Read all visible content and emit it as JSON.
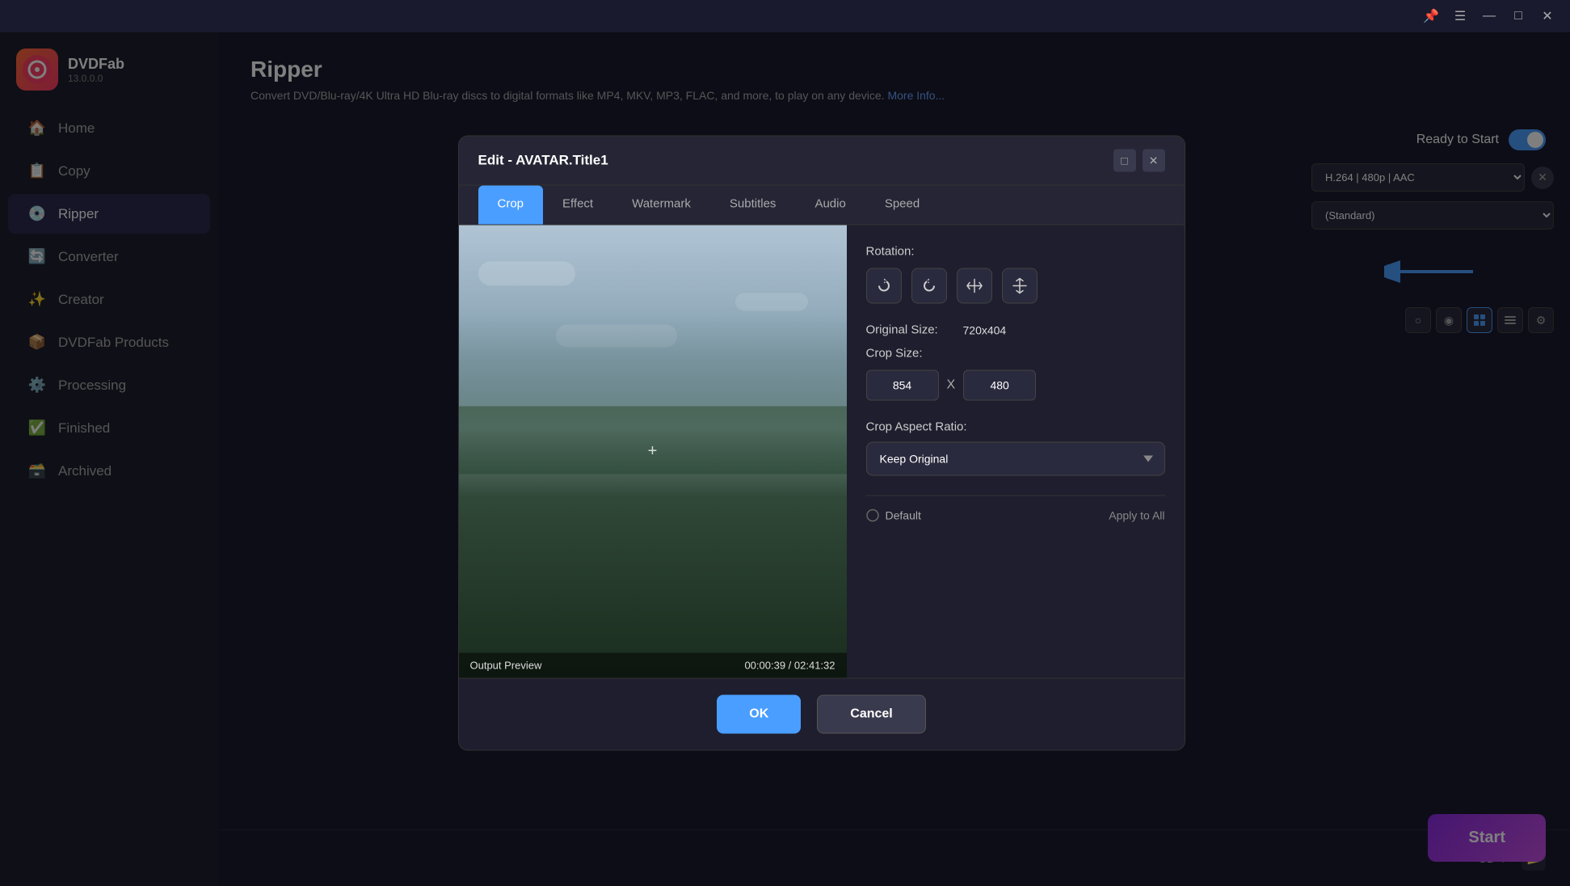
{
  "app": {
    "name": "DVDFab",
    "version": "13.0.0.0"
  },
  "titlebar": {
    "minimize": "—",
    "maximize": "□",
    "close": "✕",
    "menu": "☰",
    "pin": "📌"
  },
  "sidebar": {
    "items": [
      {
        "id": "home",
        "label": "Home",
        "icon": "🏠"
      },
      {
        "id": "copy",
        "label": "Copy",
        "icon": "📋"
      },
      {
        "id": "ripper",
        "label": "Ripper",
        "icon": "💿",
        "active": true
      },
      {
        "id": "converter",
        "label": "Converter",
        "icon": "🔄"
      },
      {
        "id": "creator",
        "label": "Creator",
        "icon": "✨"
      },
      {
        "id": "dvdfab-products",
        "label": "DVDFab Products",
        "icon": "📦"
      },
      {
        "id": "processing",
        "label": "Processing",
        "icon": "⚙️"
      },
      {
        "id": "finished",
        "label": "Finished",
        "icon": "✅"
      },
      {
        "id": "archived",
        "label": "Archived",
        "icon": "🗃️"
      }
    ]
  },
  "main": {
    "title": "Ripper",
    "description": "Convert DVD/Blu-ray/4K Ultra HD Blu-ray discs to digital formats like MP4, MKV, MP3, FLAC, and more, to play on any device.",
    "more_info_link": "More Info..."
  },
  "right_panel": {
    "ready_to_start": "Ready to Start",
    "format_label": "H.264 | 480p | AAC",
    "profile_label": "(Standard)",
    "close_btn": "✕"
  },
  "modal": {
    "title": "Edit - AVATAR.Title1",
    "tabs": [
      {
        "id": "crop",
        "label": "Crop",
        "active": true
      },
      {
        "id": "effect",
        "label": "Effect"
      },
      {
        "id": "watermark",
        "label": "Watermark"
      },
      {
        "id": "subtitles",
        "label": "Subtitles"
      },
      {
        "id": "audio",
        "label": "Audio"
      },
      {
        "id": "speed",
        "label": "Speed"
      }
    ],
    "video": {
      "output_preview": "Output Preview",
      "timestamp": "00:00:39 / 02:41:32"
    },
    "controls": {
      "rotation_label": "Rotation:",
      "rotation_btns": [
        "↻",
        "↺",
        "⇌",
        "⇅"
      ],
      "original_size_label": "Original Size:",
      "original_size_value": "720x404",
      "crop_size_label": "Crop Size:",
      "crop_width": "854",
      "crop_x_separator": "X",
      "crop_height": "480",
      "crop_aspect_ratio_label": "Crop Aspect Ratio:",
      "crop_aspect_ratio_value": "Keep Original",
      "default_label": "Default",
      "apply_to_all": "Apply to All"
    },
    "footer": {
      "ok_label": "OK",
      "cancel_label": "Cancel"
    }
  },
  "bottom": {
    "storage": "GB ▼",
    "folder_icon": "📁",
    "start_label": "Start"
  }
}
